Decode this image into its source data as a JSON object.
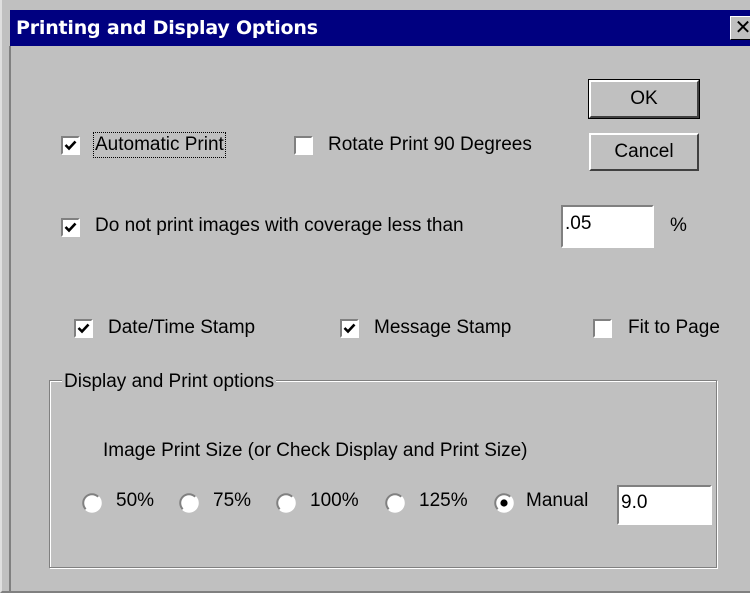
{
  "dialog": {
    "title": "Printing and Display Options",
    "close_glyph": "✕"
  },
  "buttons": {
    "ok": "OK",
    "cancel": "Cancel"
  },
  "options": {
    "automatic_print": {
      "label": "Automatic Print",
      "checked": true
    },
    "rotate_print": {
      "label": "Rotate Print 90 Degrees",
      "checked": false
    },
    "coverage": {
      "label": "Do not print images with coverage less than",
      "checked": true,
      "value": ".05",
      "unit": "%"
    },
    "date_time_stamp": {
      "label": "Date/Time Stamp",
      "checked": true
    },
    "message_stamp": {
      "label": "Message Stamp",
      "checked": true
    },
    "fit_to_page": {
      "label": "Fit to Page",
      "checked": false
    }
  },
  "display_print": {
    "group_title": "Display and Print options",
    "size_label": "Image Print Size (or Check Display and Print Size)",
    "sizes": [
      {
        "label": "50%",
        "selected": false
      },
      {
        "label": "75%",
        "selected": false
      },
      {
        "label": "100%",
        "selected": false
      },
      {
        "label": "125%",
        "selected": false
      },
      {
        "label": "Manual",
        "selected": true
      }
    ],
    "manual_value": "9.0"
  },
  "icons": {
    "checkbox_checked": "check-mark-icon",
    "radio_selected": "radio-dot-icon",
    "close": "close-icon"
  }
}
